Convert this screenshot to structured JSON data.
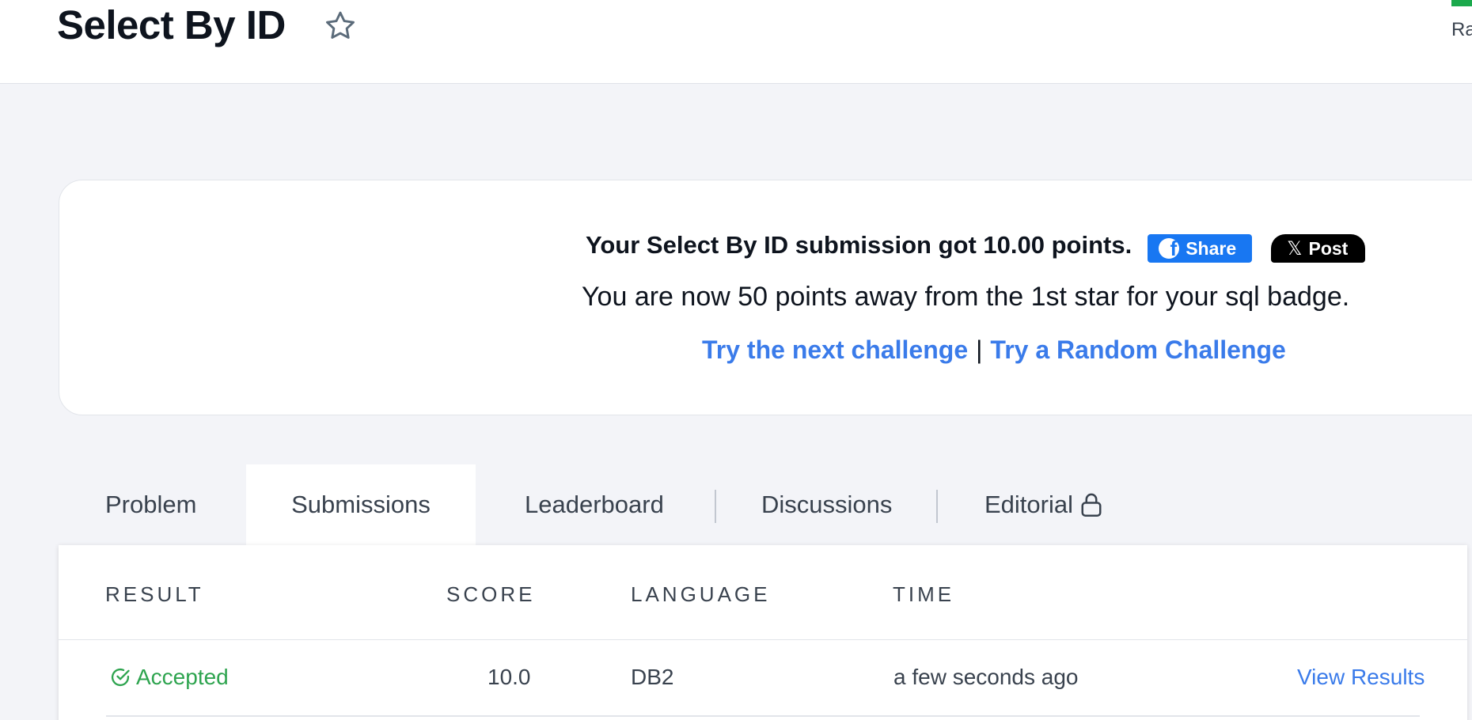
{
  "header": {
    "title": "Select By ID",
    "right_text": "Ra",
    "accent_color": "#1ba94c"
  },
  "result": {
    "message": "Your Select By ID submission got 10.00 points.",
    "share_label": "Share",
    "post_label": "Post",
    "progress_text": "You are now 50 points away from the 1st star for your sql badge.",
    "next_challenge_label": "Try the next challenge",
    "separator": "|",
    "random_challenge_label": "Try a Random Challenge"
  },
  "tabs": [
    {
      "label": "Problem",
      "active": false
    },
    {
      "label": "Submissions",
      "active": true
    },
    {
      "label": "Leaderboard",
      "active": false
    },
    {
      "label": "Discussions",
      "active": false
    },
    {
      "label": "Editorial",
      "active": false,
      "locked": true
    }
  ],
  "table": {
    "headers": [
      "RESULT",
      "SCORE",
      "LANGUAGE",
      "TIME"
    ],
    "rows": [
      {
        "result": "Accepted",
        "score": "10.0",
        "language": "DB2",
        "time": "a few seconds ago",
        "action": "View Results"
      }
    ]
  },
  "colors": {
    "link": "#3a7bea",
    "success": "#2ea44f",
    "facebook": "#1877f2",
    "x_post": "#000000",
    "background": "#f3f4f8"
  },
  "icons": [
    "star-icon",
    "facebook-icon",
    "x-icon",
    "lock-icon",
    "check-circle-icon"
  ]
}
